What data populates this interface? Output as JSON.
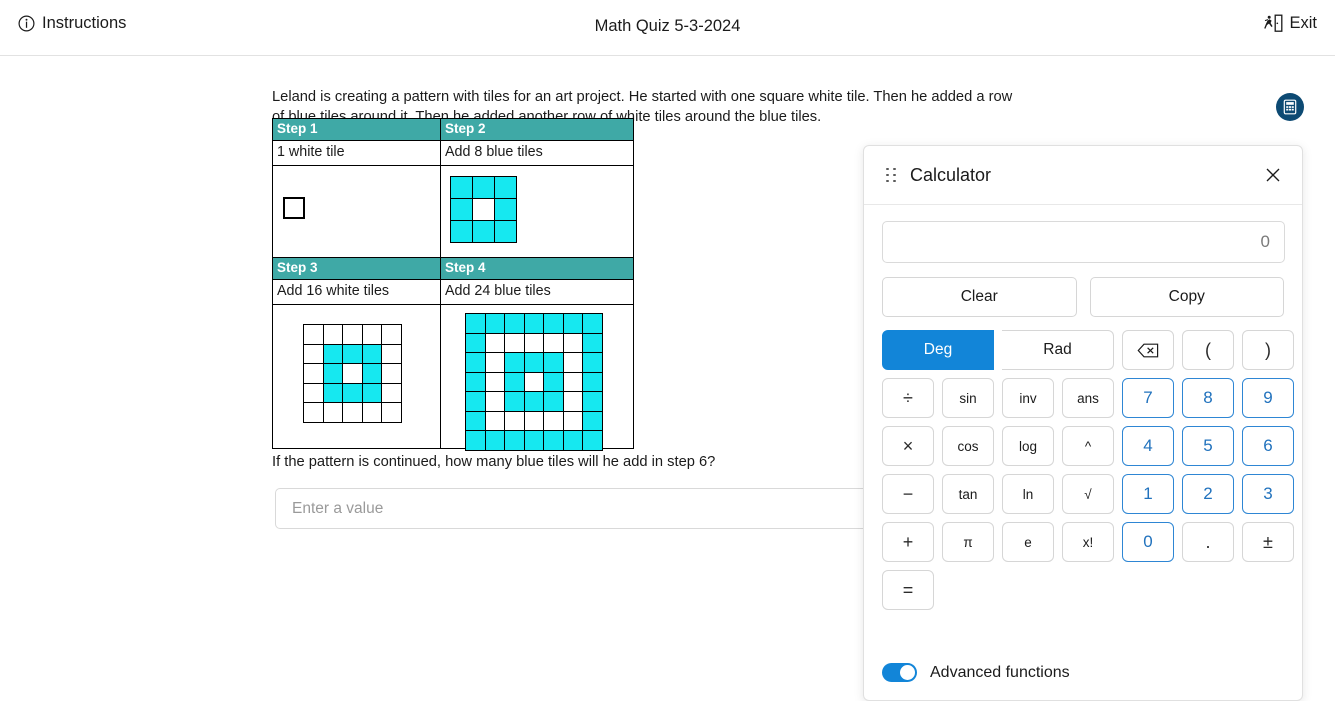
{
  "topbar": {
    "instructions_label": "Instructions",
    "title": "Math Quiz 5-3-2024",
    "exit_label": "Exit",
    "info_icon": "info-circle-icon",
    "exit_icon": "exit-door-runner-icon"
  },
  "question": {
    "stem": "Leland is creating a pattern with tiles for an art project. He started with one square white tile. Then he added a row of blue tiles around it. Then he added another row of white tiles around the blue tiles.",
    "prompt": "If the pattern is continued, how many blue tiles will he add in step 6?",
    "input_placeholder": "Enter a value",
    "input_value": ""
  },
  "pattern_table": {
    "header_color": "#3fa9a6",
    "blue_tile_color": "#16e8f0",
    "steps": [
      {
        "header": "Step 1",
        "label": "1 white tile"
      },
      {
        "header": "Step 2",
        "label": "Add 8 blue tiles"
      },
      {
        "header": "Step 3",
        "label": "Add 16 white tiles"
      },
      {
        "header": "Step 4",
        "label": "Add 24 blue tiles"
      }
    ]
  },
  "calc_launcher": {
    "icon": "calculator-icon",
    "color": "#0d4a73"
  },
  "calculator": {
    "title": "Calculator",
    "drag_handle_icon": "drag-handle-icon",
    "close_icon": "close-icon",
    "display_value": "0",
    "clear_label": "Clear",
    "copy_label": "Copy",
    "deg_label": "Deg",
    "rad_label": "Rad",
    "active_angle_mode": "Deg",
    "accent_color": "#1285d8",
    "number_color": "#2172bd",
    "keys": {
      "row1": [
        "sin",
        "inv",
        "ans",
        "7",
        "8",
        "9",
        "×"
      ],
      "row2": [
        "cos",
        "log",
        "^",
        "4",
        "5",
        "6",
        "−"
      ],
      "row3": [
        "tan",
        "ln",
        "√",
        "1",
        "2",
        "3",
        "+"
      ],
      "row4": [
        "π",
        "e",
        "x!",
        "0",
        ".",
        "±",
        "="
      ],
      "top_ops": [
        "backspace",
        "(",
        ")",
        "÷"
      ]
    },
    "backspace_icon": "backspace-icon",
    "advanced_label": "Advanced functions",
    "advanced_on": true
  }
}
